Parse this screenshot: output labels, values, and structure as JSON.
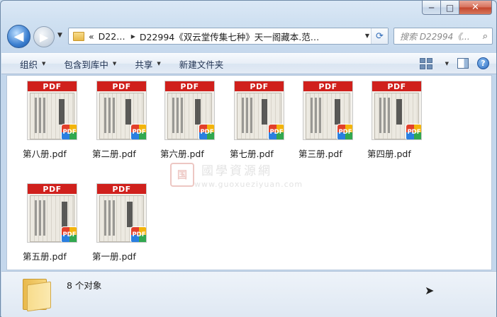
{
  "window": {
    "caption_buttons": {
      "minimize": "─",
      "maximize": "□",
      "close": "✕"
    }
  },
  "nav": {
    "back_glyph": "◀",
    "forward_glyph": "▶",
    "breadcrumb": [
      "«",
      "D22…",
      "D22994《双云堂传集七种》天一阁藏本.范…"
    ],
    "search_placeholder": "搜索 D22994《..."
  },
  "toolbar": {
    "items": [
      "组织",
      "包含到库中",
      "共享",
      "新建文件夹"
    ]
  },
  "files": [
    {
      "name": "第八册.pdf",
      "band": "PDF",
      "badge": "PDF"
    },
    {
      "name": "第二册.pdf",
      "band": "PDF",
      "badge": "PDF"
    },
    {
      "name": "第六册.pdf",
      "band": "PDF",
      "badge": "PDF"
    },
    {
      "name": "第七册.pdf",
      "band": "PDF",
      "badge": "PDF"
    },
    {
      "name": "第三册.pdf",
      "band": "PDF",
      "badge": "PDF"
    },
    {
      "name": "第四册.pdf",
      "band": "PDF",
      "badge": "PDF"
    },
    {
      "name": "第五册.pdf",
      "band": "PDF",
      "badge": "PDF"
    },
    {
      "name": "第一册.pdf",
      "band": "PDF",
      "badge": "PDF"
    }
  ],
  "watermark": {
    "seal": "国",
    "text": "國學資源網",
    "url": "www.guoxueziyuan.com"
  },
  "details": {
    "count_text": "8 个对象"
  },
  "colors": {
    "pdf_band": "#d0201c",
    "accent": "#2c6cc1"
  },
  "icons": [
    "back-icon",
    "forward-icon",
    "folder-icon",
    "refresh-icon",
    "search-icon",
    "views-icon",
    "preview-pane-icon",
    "help-icon",
    "pdf-badge-icon"
  ]
}
